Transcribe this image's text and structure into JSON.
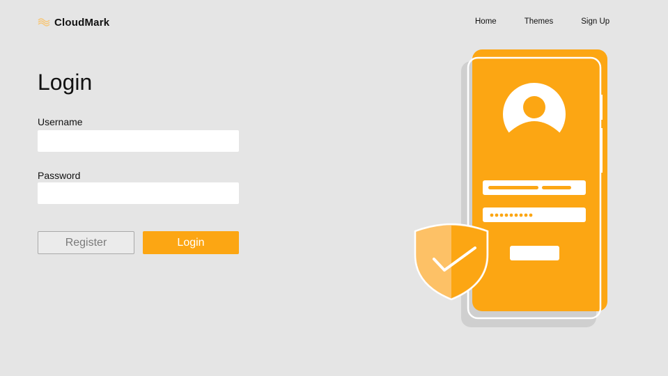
{
  "brand": {
    "name": "CloudMark",
    "logo_icon": "wave-logo-icon",
    "logo_color": "#f6c77a"
  },
  "nav": {
    "items": [
      "Home",
      "Themes",
      "Sign Up"
    ]
  },
  "form": {
    "title": "Login",
    "username_label": "Username",
    "username_value": "",
    "password_label": "Password",
    "password_value": "",
    "register_label": "Register",
    "login_label": "Login"
  },
  "illustration": {
    "phone_color": "#fca613",
    "shield_color": "#fdc166",
    "icons": [
      "phone-icon",
      "user-avatar-icon",
      "shield-check-icon"
    ]
  },
  "colors": {
    "accent": "#fca613",
    "background": "#e5e5e5"
  }
}
